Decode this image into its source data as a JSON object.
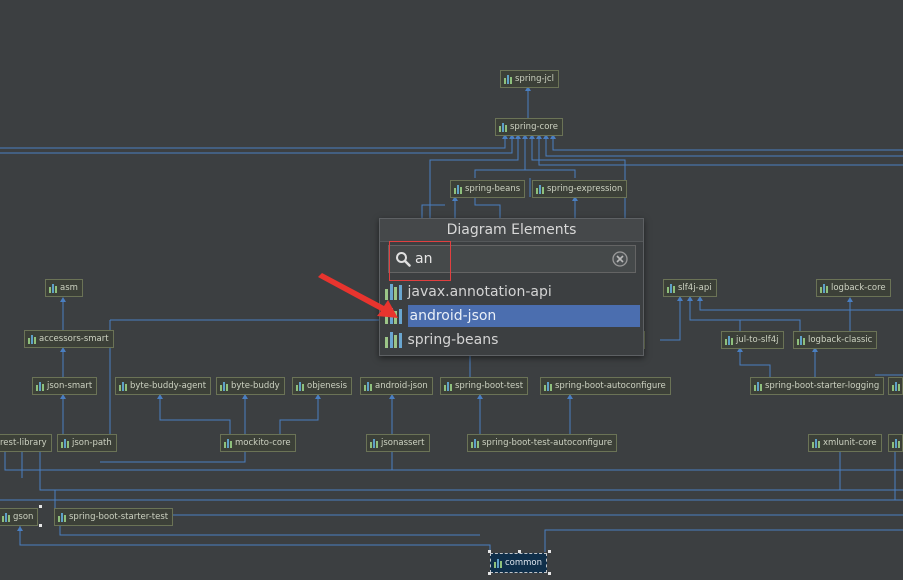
{
  "popup": {
    "title": "Diagram Elements",
    "search_value": "an",
    "results": [
      "javax.annotation-api",
      "android-json",
      "spring-beans"
    ],
    "selected_index": 1
  },
  "nodes": {
    "spring_jcl": "spring-jcl",
    "spring_core": "spring-core",
    "spring_beans": "spring-beans",
    "spring_expression": "spring-expression",
    "asm": "asm",
    "accessors_smart": "accessors-smart",
    "json_smart": "json-smart",
    "byte_buddy_agent": "byte-buddy-agent",
    "byte_buddy": "byte-buddy",
    "objenesis": "objenesis",
    "android_json": "android-json",
    "spring_boot_test": "spring-boot-test",
    "spring_boot_autoconfigure": "spring-boot-autoconfigure",
    "slf4j_api": "slf4j-api",
    "logback_core": "logback-core",
    "jul_to_slf4j": "jul-to-slf4j",
    "logback_classic": "logback-classic",
    "spring_boot_starter_logging": "spring-boot-starter-logging",
    "st_partial": "st",
    "hamcrest_library": "rest-library",
    "json_path": "json-path",
    "mockito_core": "mockito-core",
    "jsonassert": "jsonassert",
    "spring_boot_test_autoconfigure": "spring-boot-test-autoconfigure",
    "xmlunit_core": "xmlunit-core",
    "gson": "gson",
    "spring_boot_starter_test": "spring-boot-starter-test",
    "common": "common"
  },
  "colors": {
    "background": "#3c3f41",
    "edge": "#4a7fc1",
    "selection": "#4b6eaf",
    "annotation_red": "#e04040"
  }
}
